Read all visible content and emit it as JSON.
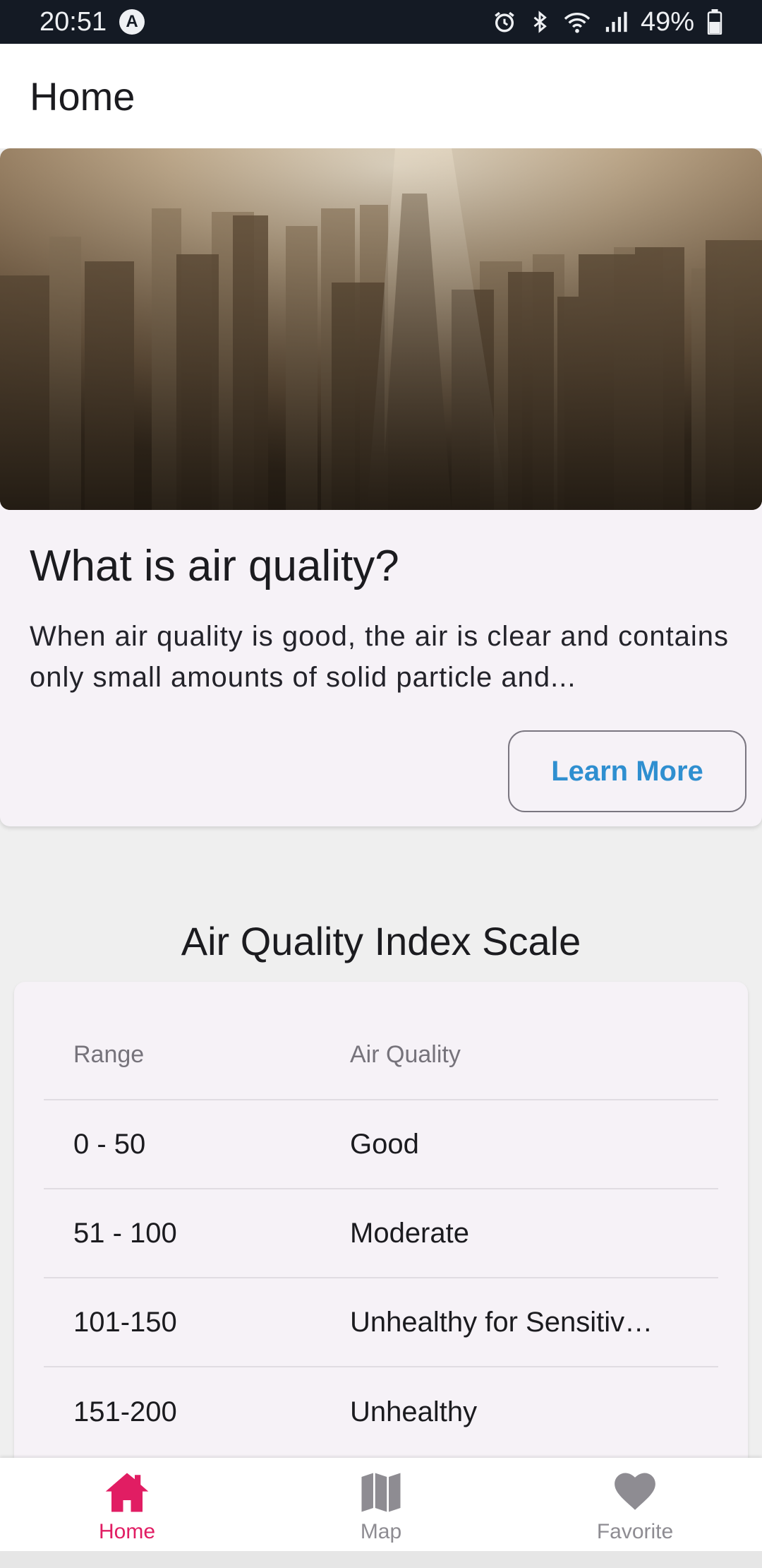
{
  "status_bar": {
    "time": "20:51",
    "notification_icon": "a-letter-icon",
    "battery_percent": "49%",
    "icons": [
      "alarm-icon",
      "bluetooth-icon",
      "wifi-icon",
      "signal-icon",
      "battery-icon"
    ]
  },
  "app_bar": {
    "title": "Home"
  },
  "info_card": {
    "image": "smoggy-city-skyline",
    "title": "What is air quality?",
    "body": "When air quality is good, the air is clear and contains only small amounts of solid particle and...",
    "button_label": "Learn More"
  },
  "scale": {
    "title": "Air Quality Index Scale",
    "columns": [
      "Range",
      "Air Quality"
    ],
    "rows": [
      {
        "range": "0 - 50",
        "quality": "Good"
      },
      {
        "range": "51 - 100",
        "quality": "Moderate"
      },
      {
        "range": "101-150",
        "quality": "Unhealthy for Sensitiv…"
      },
      {
        "range": "151-200",
        "quality": "Unhealthy"
      }
    ]
  },
  "bottom_nav": {
    "items": [
      {
        "label": "Home",
        "icon": "home-icon",
        "active": true
      },
      {
        "label": "Map",
        "icon": "map-icon",
        "active": false
      },
      {
        "label": "Favorite",
        "icon": "heart-icon",
        "active": false
      }
    ]
  },
  "colors": {
    "accent": "#e11d63",
    "link": "#2f8fd0",
    "status_bar": "#141a24",
    "card_background": "#f6f2f7"
  }
}
